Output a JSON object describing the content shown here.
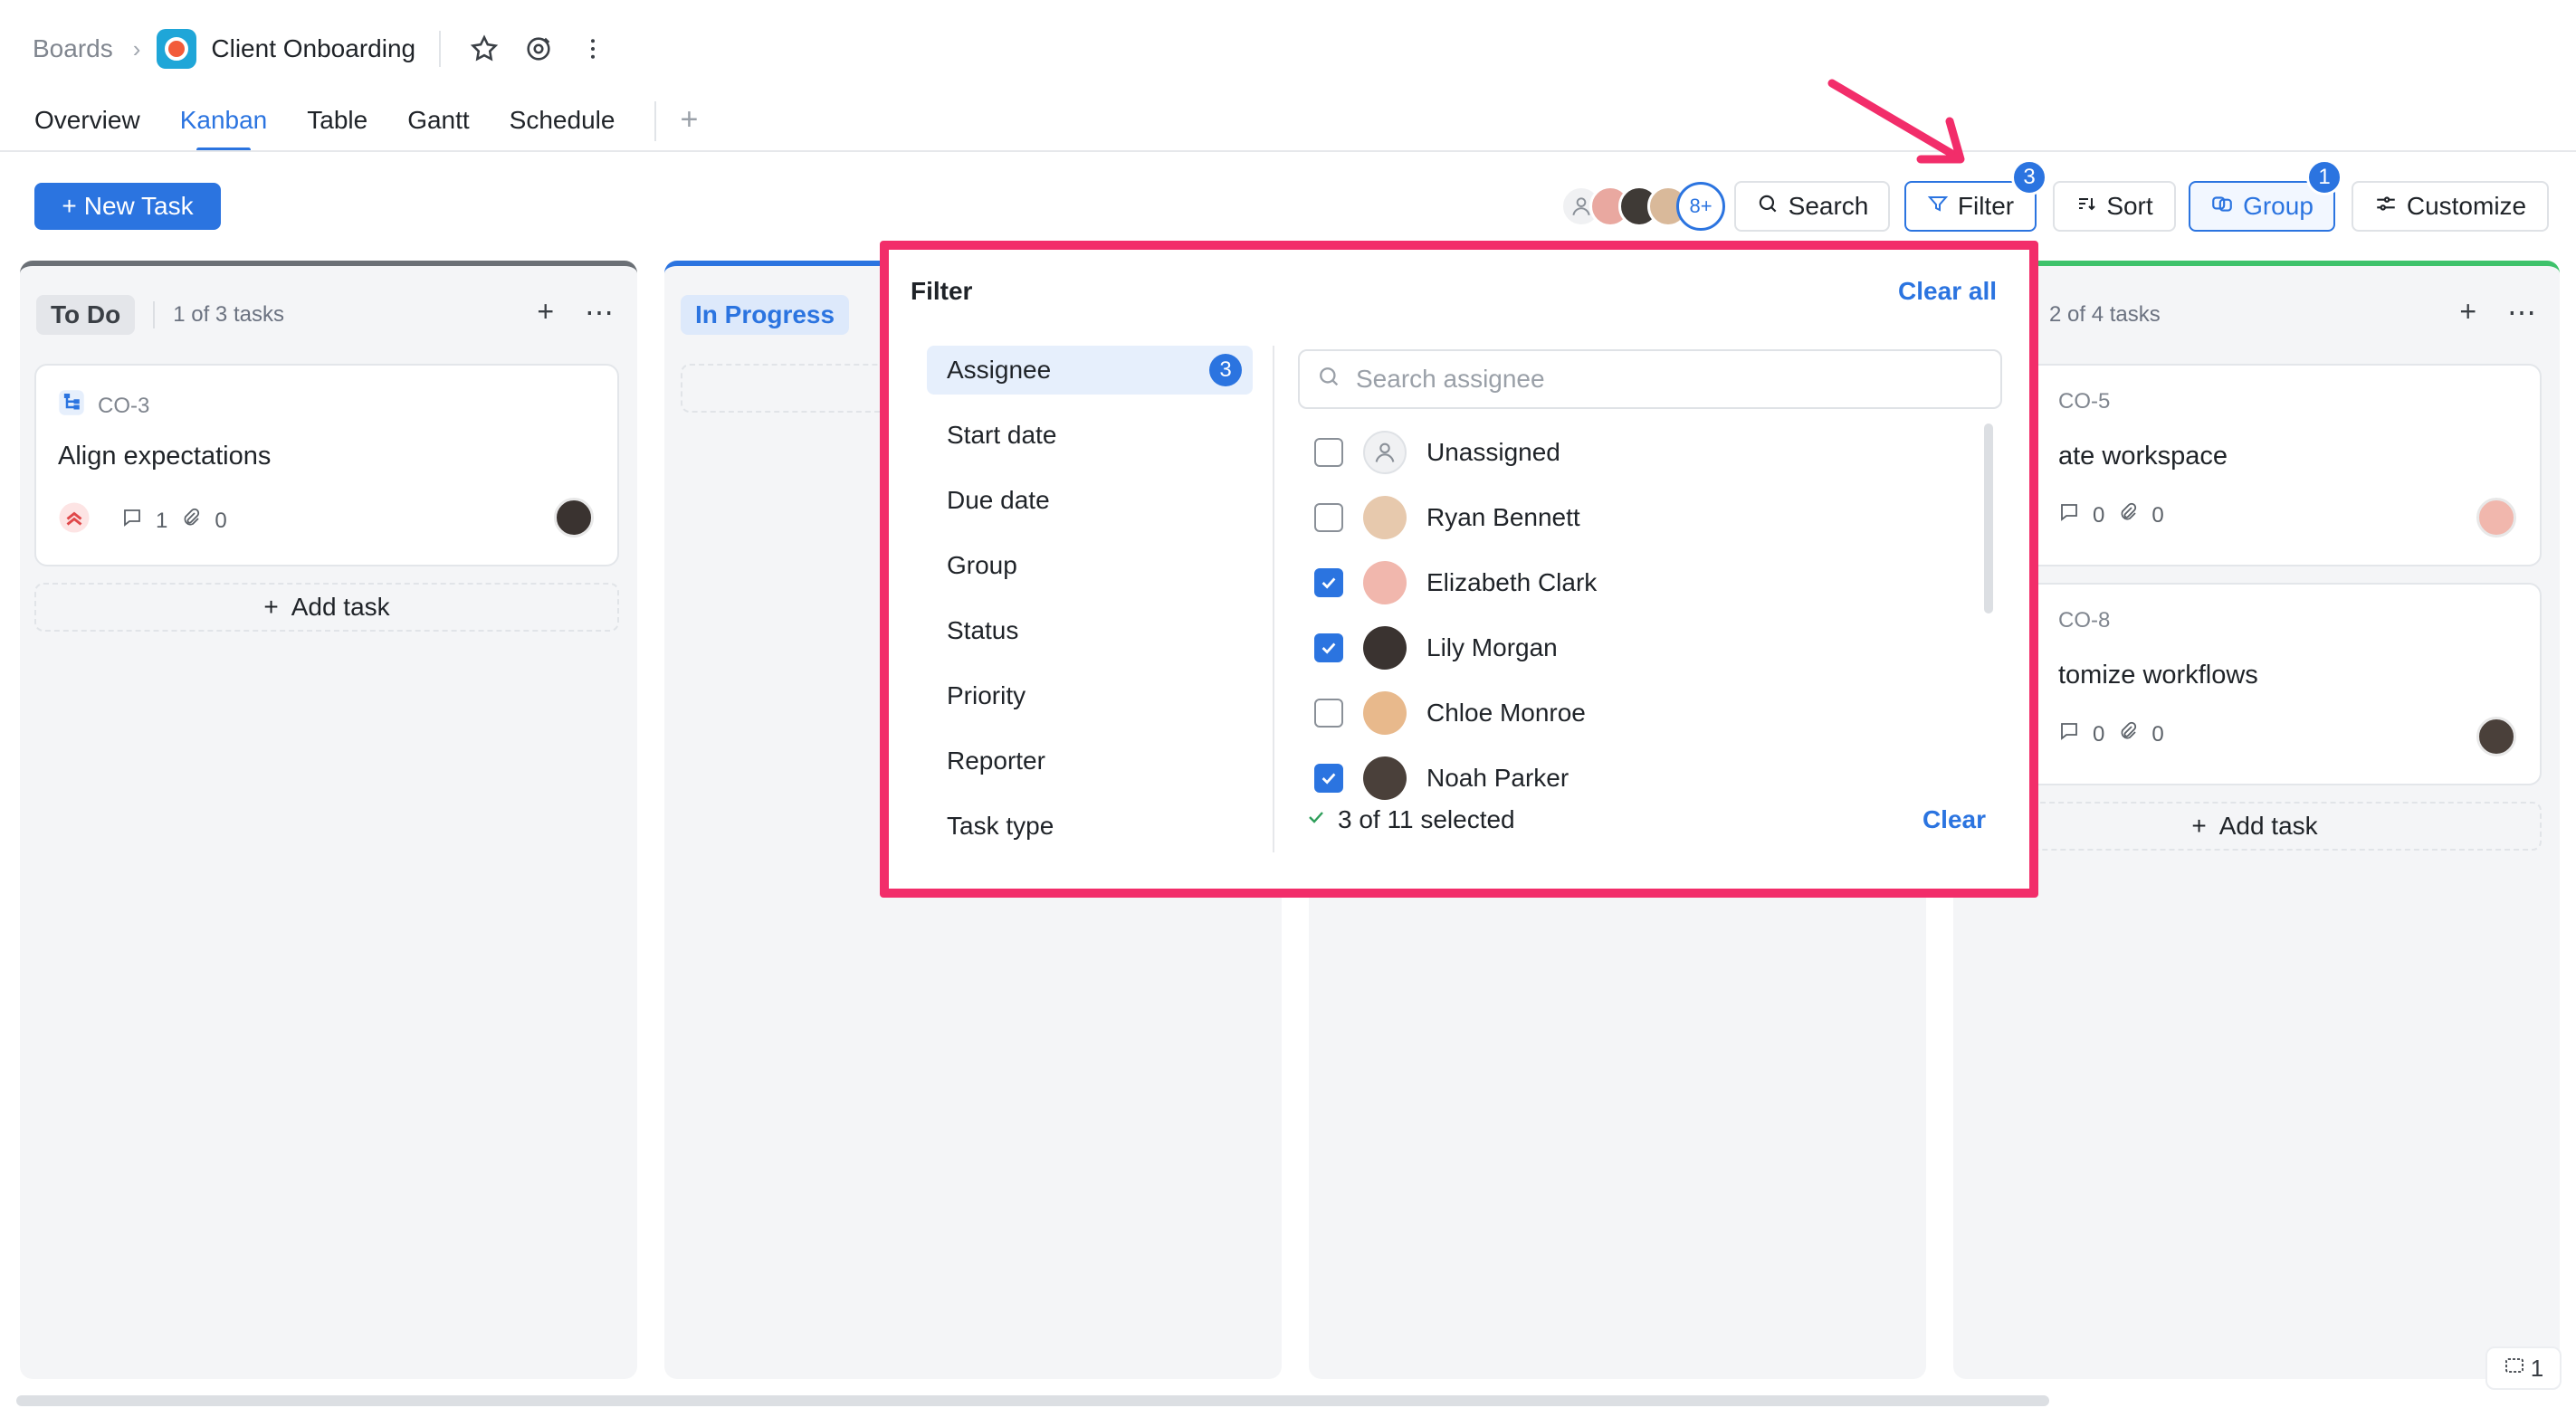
{
  "breadcrumb": {
    "root": "Boards",
    "current": "Client Onboarding"
  },
  "tabs": [
    {
      "label": "Overview",
      "active": false
    },
    {
      "label": "Kanban",
      "active": true
    },
    {
      "label": "Table",
      "active": false
    },
    {
      "label": "Gantt",
      "active": false
    },
    {
      "label": "Schedule",
      "active": false
    }
  ],
  "toolbar": {
    "new_task": "New Task",
    "avatar_overflow": "8+",
    "search": "Search",
    "filter": "Filter",
    "filter_count": "3",
    "sort": "Sort",
    "group": "Group",
    "group_count": "1",
    "customize": "Customize"
  },
  "columns": [
    {
      "status": "To Do",
      "count_text": "1 of 3 tasks",
      "cards": [
        {
          "key": "CO-3",
          "title": "Align expectations",
          "comments": "1",
          "attachments": "0"
        }
      ],
      "add_task": "Add task"
    },
    {
      "status": "In Progress"
    },
    {
      "count_text": "2 of 4 tasks",
      "cards": [
        {
          "key": "CO-5",
          "title": "ate workspace",
          "comments": "0",
          "attachments": "0"
        },
        {
          "key": "CO-8",
          "title": "tomize workflows",
          "comments": "0",
          "attachments": "0"
        }
      ],
      "add_task": "Add task"
    }
  ],
  "filter_popover": {
    "title": "Filter",
    "clear_all": "Clear all",
    "fields": [
      {
        "label": "Assignee",
        "count": "3",
        "active": true
      },
      {
        "label": "Start date"
      },
      {
        "label": "Due date"
      },
      {
        "label": "Group"
      },
      {
        "label": "Status"
      },
      {
        "label": "Priority"
      },
      {
        "label": "Reporter"
      },
      {
        "label": "Task type"
      }
    ],
    "search_placeholder": "Search assignee",
    "options": [
      {
        "label": "Unassigned",
        "checked": false
      },
      {
        "label": "Ryan Bennett",
        "checked": false
      },
      {
        "label": "Elizabeth Clark",
        "checked": true
      },
      {
        "label": "Lily Morgan",
        "checked": true
      },
      {
        "label": "Chloe Monroe",
        "checked": false
      },
      {
        "label": "Noah Parker",
        "checked": true
      }
    ],
    "selected_text": "3 of 11 selected",
    "clear": "Clear"
  },
  "corner_count": "1",
  "colors": {
    "accent": "#2b74e0",
    "highlight": "#f22d6a",
    "done": "#3ec26b"
  }
}
